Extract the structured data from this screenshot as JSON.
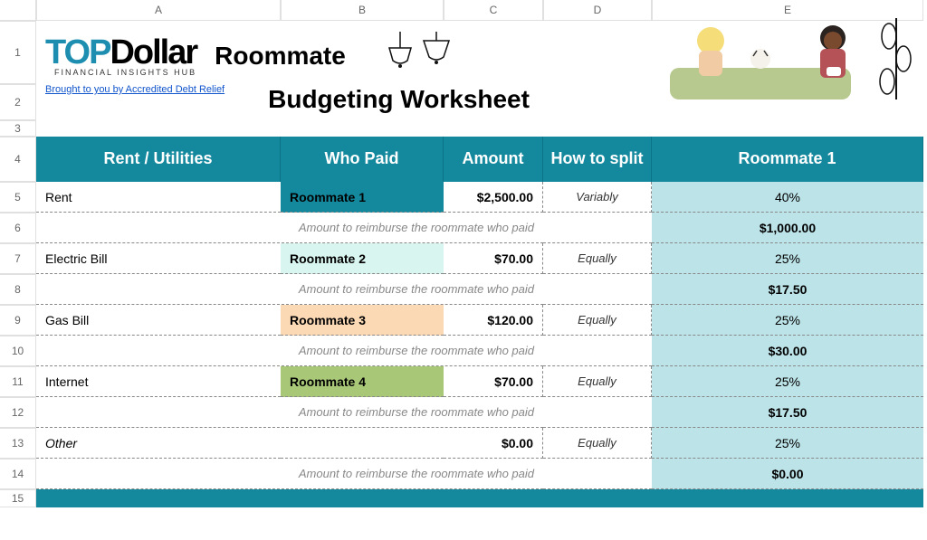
{
  "columns": [
    "A",
    "B",
    "C",
    "D",
    "E"
  ],
  "rows": [
    "1",
    "2",
    "3",
    "4",
    "5",
    "6",
    "7",
    "8",
    "9",
    "10",
    "11",
    "12",
    "13",
    "14",
    "15"
  ],
  "logo": {
    "text_top": "TOP",
    "text_dollar": "Dollar",
    "subtitle": "FINANCIAL INSIGHTS HUB"
  },
  "credit": "Brought to you by Accredited Debt Relief",
  "worksheet_title_line1": "Roommate",
  "worksheet_title_line2": "Budgeting Worksheet",
  "headers": {
    "a": "Rent / Utilities",
    "b": "Who Paid",
    "c": "Amount",
    "d": "How to split",
    "e": "Roommate 1"
  },
  "reimburse_label": "Amount to reimburse the roommate who paid",
  "items": [
    {
      "name": "Rent",
      "who": "Roommate 1",
      "amount": "$2,500.00",
      "split": "Variably",
      "share": "40%",
      "reimburse": "$1,000.00"
    },
    {
      "name": "Electric Bill",
      "who": "Roommate 2",
      "amount": "$70.00",
      "split": "Equally",
      "share": "25%",
      "reimburse": "$17.50"
    },
    {
      "name": "Gas Bill",
      "who": "Roommate 3",
      "amount": "$120.00",
      "split": "Equally",
      "share": "25%",
      "reimburse": "$30.00"
    },
    {
      "name": "Internet",
      "who": "Roommate 4",
      "amount": "$70.00",
      "split": "Equally",
      "share": "25%",
      "reimburse": "$17.50"
    },
    {
      "name": "Other",
      "who": "",
      "amount": "$0.00",
      "split": "Equally",
      "share": "25%",
      "reimburse": "$0.00"
    }
  ]
}
